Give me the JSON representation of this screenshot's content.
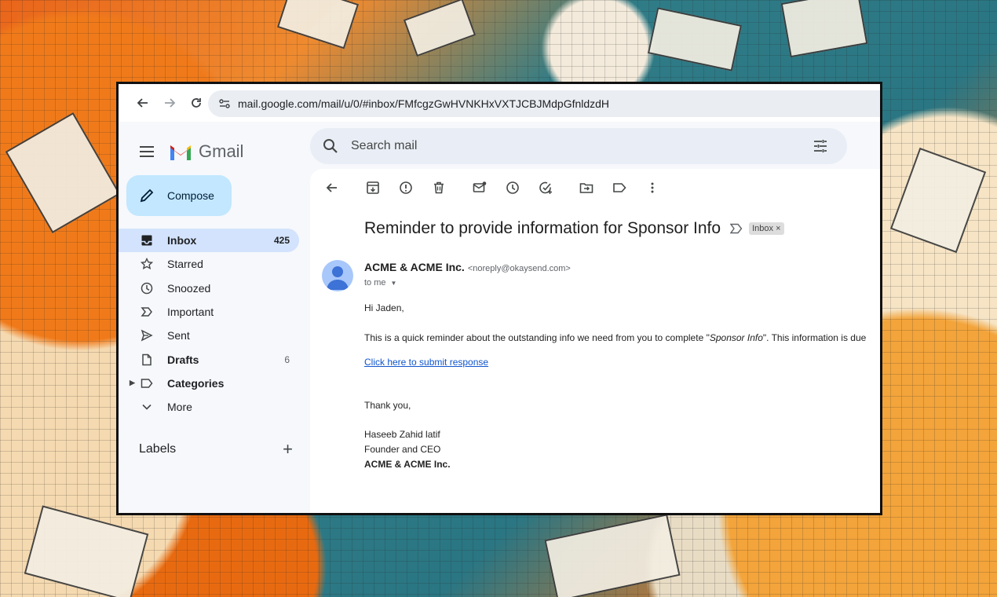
{
  "browser": {
    "url": "mail.google.com/mail/u/0/#inbox/FMfcgzGwHVNKHxVXTJCBJMdpGfnldzdH"
  },
  "app": {
    "title": "Gmail",
    "compose_label": "Compose",
    "search_placeholder": "Search mail"
  },
  "sidebar": {
    "items": [
      {
        "label": "Inbox",
        "count": "425"
      },
      {
        "label": "Starred",
        "count": ""
      },
      {
        "label": "Snoozed",
        "count": ""
      },
      {
        "label": "Important",
        "count": ""
      },
      {
        "label": "Sent",
        "count": ""
      },
      {
        "label": "Drafts",
        "count": "6"
      },
      {
        "label": "Categories",
        "count": ""
      },
      {
        "label": "More",
        "count": ""
      }
    ],
    "labels_header": "Labels",
    "labels_add": "+"
  },
  "email": {
    "subject": "Reminder to provide information for Sponsor Info",
    "chip": "Inbox",
    "chip_close": "×",
    "sender_name": "ACME & ACME Inc.",
    "sender_email": "<noreply@okaysend.com>",
    "recipient": "to me",
    "greeting": "Hi Jaden,",
    "body_before": "This is a quick reminder about the outstanding info we need from you to complete \"",
    "body_em": "Sponsor Info",
    "body_after": "\". This information is due",
    "link": "Click here to submit response",
    "thanks": "Thank you,",
    "sig_name": "Haseeb Zahid latif",
    "sig_title": "Founder and CEO",
    "sig_company": "ACME & ACME Inc."
  },
  "colors": {
    "active_nav": "#d3e3fd",
    "compose_bg": "#c2e7ff",
    "search_bg": "#e9eef6",
    "link": "#1155cc",
    "gmail_red": "#ea4335",
    "gmail_blue": "#4285f4",
    "gmail_green": "#34a853",
    "gmail_yellow": "#fbbc04"
  }
}
